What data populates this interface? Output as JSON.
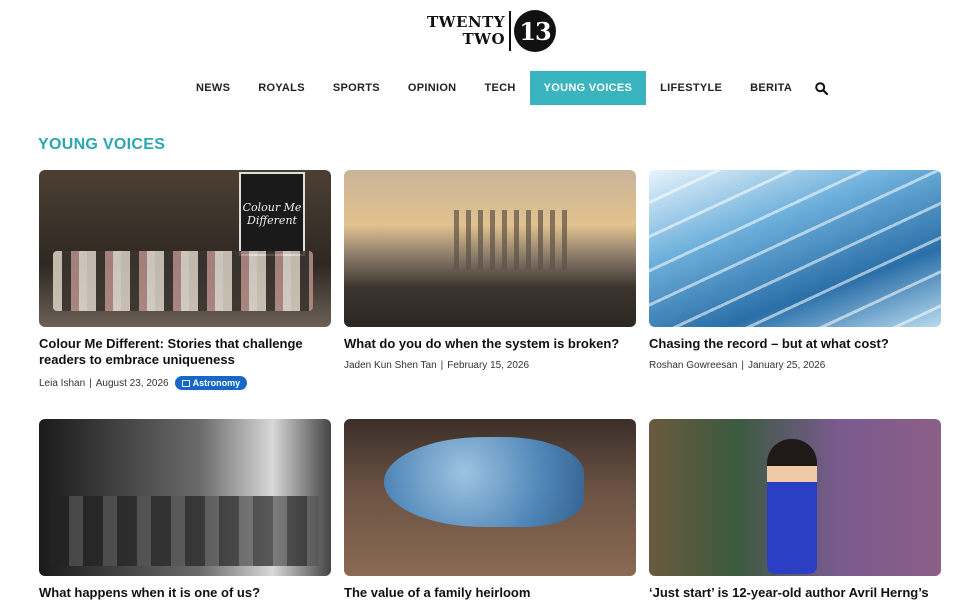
{
  "logo": {
    "line1": "TWENTY",
    "line2": "TWO",
    "number": "13"
  },
  "nav": {
    "items": [
      "NEWS",
      "ROYALS",
      "SPORTS",
      "OPINION",
      "TECH",
      "YOUNG VOICES",
      "LIFESTYLE",
      "BERITA"
    ],
    "active": "YOUNG VOICES"
  },
  "section_title": "YOUNG VOICES",
  "poster_text": "Colour Me Different",
  "articles": [
    {
      "title": "Colour Me Different: Stories that challenge readers to embrace uniqueness",
      "author": "Leia Ishan",
      "date": "August 23, 2026",
      "tag": "Astronomy"
    },
    {
      "title": "What do you do when the system is broken?",
      "author": "Jaden Kun Shen Tan",
      "date": "February 15, 2026"
    },
    {
      "title": "Chasing the record – but at what cost?",
      "author": "Roshan Gowreesan",
      "date": "January 25, 2026"
    },
    {
      "title": "What happens when it is one of us?"
    },
    {
      "title": "The value of a family heirloom"
    },
    {
      "title": "‘Just start’ is 12-year-old author Avril Herng’s"
    }
  ],
  "colors": {
    "accent": "#3ab4be",
    "section_title": "#2ba7b1",
    "tag": "#1667c8"
  },
  "icons": {
    "search": "search-icon",
    "tag": "calendar-icon"
  }
}
